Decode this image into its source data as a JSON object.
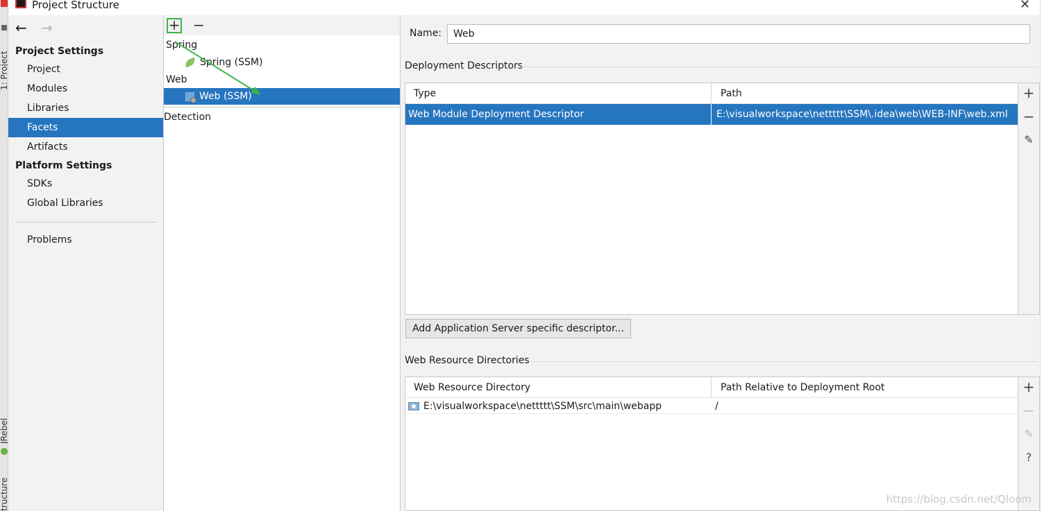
{
  "window": {
    "title": "Project Structure",
    "close_glyph": "✕"
  },
  "ide_strip": {
    "tab_project": "1: Project",
    "tab_jrebel": "JRebel",
    "tab_structure": "tructure"
  },
  "nav": {
    "back_glyph": "←",
    "forward_glyph": "→"
  },
  "sidebar": {
    "project_settings_header": "Project Settings",
    "project_items": [
      "Project",
      "Modules",
      "Libraries",
      "Facets",
      "Artifacts"
    ],
    "selected_item": "Facets",
    "platform_settings_header": "Platform Settings",
    "platform_items": [
      "SDKs",
      "Global Libraries"
    ],
    "problems": "Problems"
  },
  "facet_tree": {
    "add_glyph": "+",
    "remove_glyph": "−",
    "groups": [
      {
        "label": "Spring",
        "child": "Spring (SSM)",
        "icon": "spring-leaf-icon"
      },
      {
        "label": "Web",
        "child": "Web (SSM)",
        "icon": "web-facet-icon"
      }
    ],
    "selected_child": "Web (SSM)",
    "detection": "Detection",
    "annotation_color": "#3ab54a"
  },
  "details": {
    "name_label": "Name:",
    "name_value": "Web",
    "deployment_descriptors": {
      "title": "Deployment Descriptors",
      "columns": [
        "Type",
        "Path"
      ],
      "rows": [
        {
          "type": "Web Module Deployment Descriptor",
          "path": "E:\\visualworkspace\\nettttt\\SSM\\.idea\\web\\WEB-INF\\web.xml"
        }
      ],
      "tools": [
        "+",
        "−",
        "✎"
      ]
    },
    "add_server_button": "Add Application Server specific descriptor...",
    "web_resource_directories": {
      "title": "Web Resource Directories",
      "columns": [
        "Web Resource Directory",
        "Path Relative to Deployment Root"
      ],
      "rows": [
        {
          "directory": "E:\\visualworkspace\\nettttt\\SSM\\src\\main\\webapp",
          "relative": "/"
        }
      ],
      "tools": [
        "+",
        "−",
        "✎",
        "?"
      ]
    }
  },
  "watermark": "https://blog.csdn.net/Qloom",
  "colors": {
    "selection": "#2675bf",
    "panel": "#f2f2f2",
    "border": "#c9c9c9"
  }
}
